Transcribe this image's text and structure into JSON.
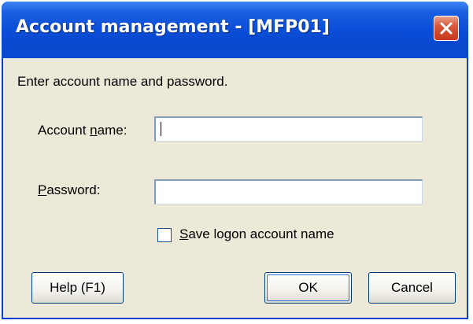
{
  "window": {
    "title": "Account management - [MFP01]",
    "close_icon": "close-icon",
    "accent_color": "#0b4ed8",
    "close_color": "#d9573a"
  },
  "form": {
    "instruction": "Enter account name and password.",
    "account_label_pre": "Account ",
    "account_label_mnemonic": "n",
    "account_label_post": "ame:",
    "account_value": "",
    "password_label_pre": "",
    "password_label_mnemonic": "P",
    "password_label_post": "assword:",
    "password_value": "",
    "save_label_pre": "",
    "save_label_mnemonic": "S",
    "save_label_post": "ave logon account name",
    "save_checked": false
  },
  "buttons": {
    "help": "Help (F1)",
    "ok": "OK",
    "cancel": "Cancel"
  }
}
